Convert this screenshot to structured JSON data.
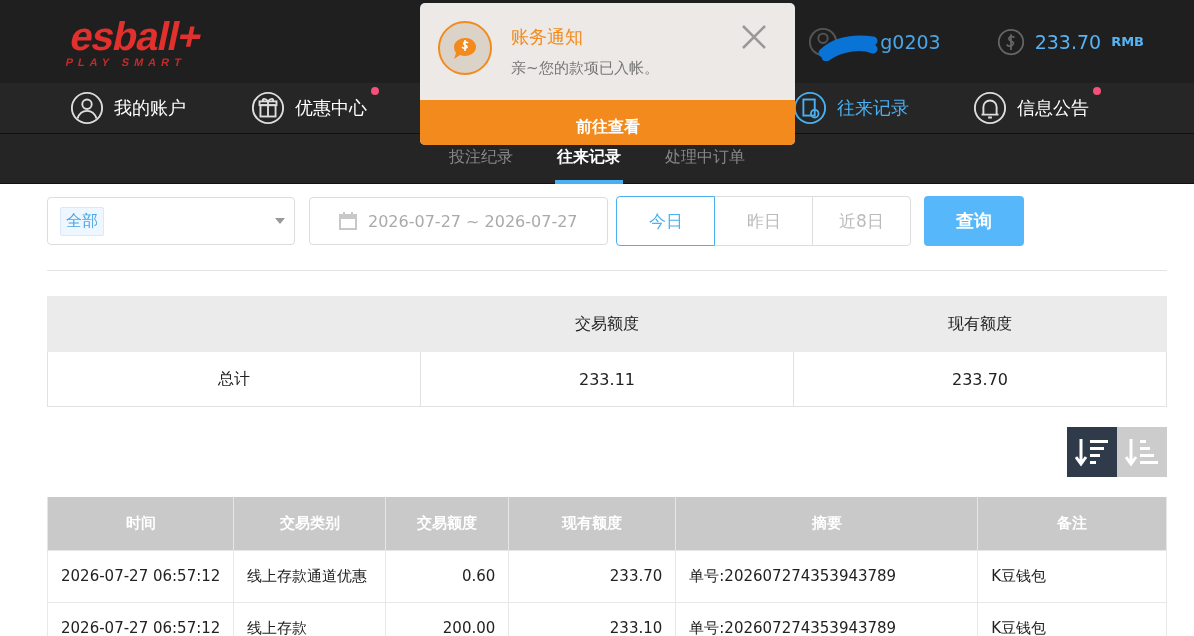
{
  "header": {
    "logo": "esball+",
    "tagline": "PLAY SMART",
    "username_visible": "g0203",
    "balance": "233.70",
    "currency": "RMB"
  },
  "nav": [
    {
      "label": "我的账户",
      "selected": false,
      "dot": false
    },
    {
      "label": "优惠中心",
      "selected": false,
      "dot": true
    },
    {
      "label": "往来记录",
      "selected": true,
      "dot": false
    },
    {
      "label": "信息公告",
      "selected": false,
      "dot": true
    }
  ],
  "subtabs": [
    {
      "label": "投注纪录",
      "selected": false
    },
    {
      "label": "往来记录",
      "selected": true
    },
    {
      "label": "处理中订单",
      "selected": false
    }
  ],
  "notification": {
    "title": "账务通知",
    "message": "亲~您的款项已入帐。",
    "action": "前往查看"
  },
  "filters": {
    "type_tag": "全部",
    "date_range": "2026-07-27 ~ 2026-07-27",
    "periods": [
      {
        "label": "今日",
        "selected": true
      },
      {
        "label": "昨日",
        "selected": false
      },
      {
        "label": "近8日",
        "selected": false
      }
    ],
    "search": "查询"
  },
  "summary": {
    "columns": [
      "交易额度",
      "现有额度"
    ],
    "row_label": "总计",
    "values": [
      "233.11",
      "233.70"
    ]
  },
  "sort": [
    {
      "selected": true
    },
    {
      "selected": false
    }
  ],
  "table": {
    "columns": [
      "时间",
      "交易类别",
      "交易额度",
      "现有额度",
      "摘要",
      "备注"
    ],
    "rows": [
      [
        "2026-07-27 06:57:12",
        "线上存款通道优惠",
        "0.60",
        "233.70",
        "单号:202607274353943789",
        "K豆钱包"
      ],
      [
        "2026-07-27 06:57:12",
        "线上存款",
        "200.00",
        "233.10",
        "单号:202607274353943789",
        "K豆钱包"
      ]
    ]
  }
}
